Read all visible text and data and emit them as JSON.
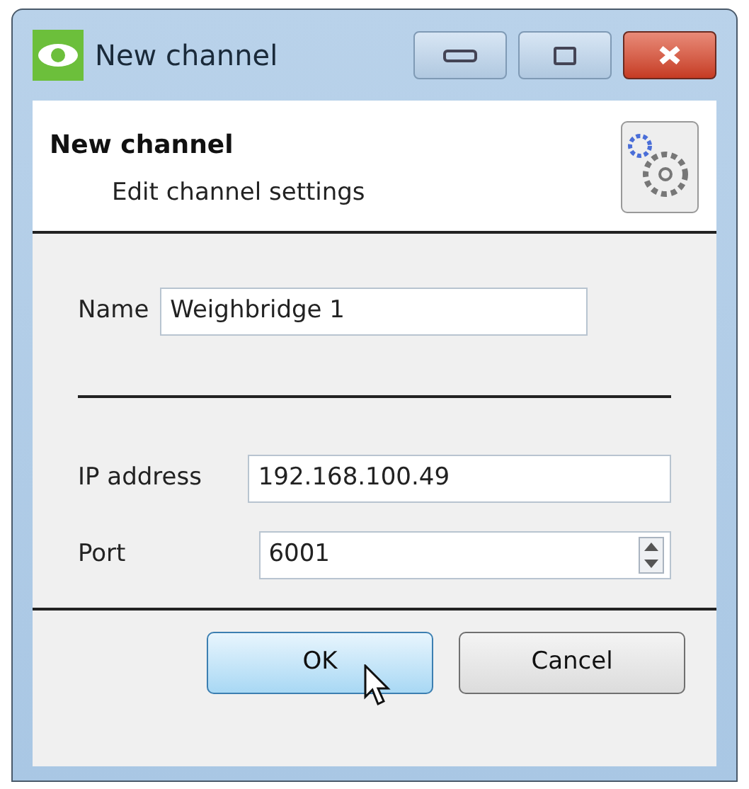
{
  "window": {
    "title": "New channel"
  },
  "header": {
    "title": "New channel",
    "subtitle": "Edit channel settings"
  },
  "name_field": {
    "label": "Name",
    "value": "Weighbridge 1"
  },
  "ip_field": {
    "label": "IP address",
    "value": "192.168.100.49"
  },
  "port_field": {
    "label": "Port",
    "value": "6001"
  },
  "buttons": [
    {
      "label": "OK",
      "hovered": true
    },
    {
      "label": "Cancel",
      "hovered": false
    }
  ]
}
